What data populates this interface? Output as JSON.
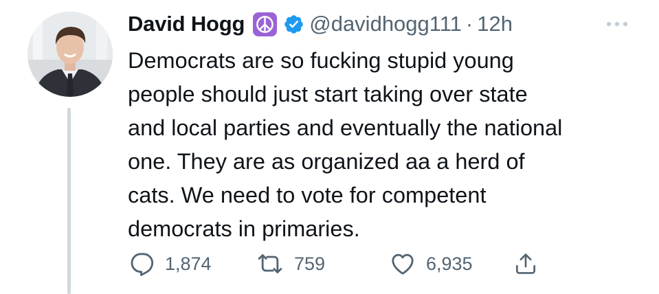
{
  "tweet": {
    "author": {
      "name": "David Hogg",
      "handle": "@davidhogg111",
      "separator": "·",
      "time": "12h"
    },
    "body": "Democrats are so fucking stupid young\npeople should just start taking over state\nand local parties and eventually the national\none. They are as organized aa a herd of\ncats. We need to vote for competent\ndemocrats in primaries.",
    "actions": {
      "replies": "1,874",
      "retweets": "759",
      "likes": "6,935"
    }
  },
  "icons": {
    "more": "more-horizontal-icon",
    "emoji": "peace-symbol-icon",
    "verified": "verified-badge-icon",
    "reply": "reply-icon",
    "retweet": "retweet-icon",
    "like": "heart-icon",
    "share": "share-icon"
  },
  "colors": {
    "text": "#0f1419",
    "secondary": "#536471",
    "verified": "#1d9bf0",
    "emoji_bg": "#9a63d4",
    "thread_line": "#cfd9de"
  }
}
